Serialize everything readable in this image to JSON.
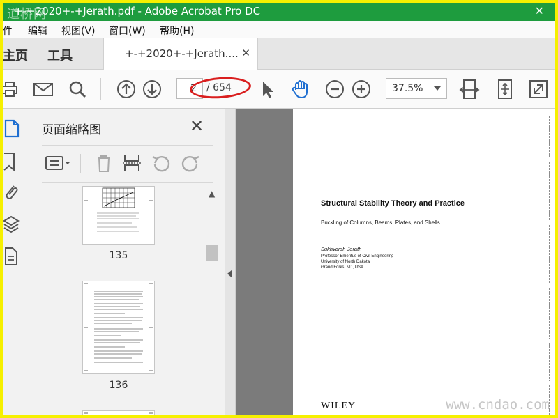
{
  "window": {
    "title": "+-+2020+-+Jerath.pdf - Adobe Acrobat Pro DC",
    "watermark": "道桥网"
  },
  "menu": [
    "文件",
    "编辑",
    "视图(V)",
    "窗口(W)",
    "帮助(H)"
  ],
  "menu_visible": [
    "件",
    "编辑",
    "视图(V)",
    "窗口(W)",
    "帮助(H)"
  ],
  "tabs": {
    "home": "主页",
    "home_visible": "主页",
    "tools": "工具",
    "document": "+-+2020+-+Jerath...."
  },
  "toolbar": {
    "page_current": "2",
    "page_total": "/ 654",
    "zoom": "37.5%",
    "annotation_color": "#d91e1e"
  },
  "thumb_panel": {
    "title": "页面缩略图",
    "thumbnails": [
      {
        "number": "135"
      },
      {
        "number": "136"
      }
    ]
  },
  "document_page": {
    "title": "Structural Stability Theory and Practice",
    "subtitle": "Buckling of Columns, Beams, Plates, and Shells",
    "author": "Sukhvarsh Jerath",
    "affiliation_lines": [
      "Professor Emeritus of Civil Engineering",
      "University of North Dakota",
      "Grand Forks, ND, USA"
    ],
    "publisher": "WILEY"
  },
  "watermark_bottom": "www.cndao.com",
  "colors": {
    "titlebar": "#1e9c3e",
    "frame": "#f6f000",
    "icon_blue": "#1f6fd1"
  }
}
